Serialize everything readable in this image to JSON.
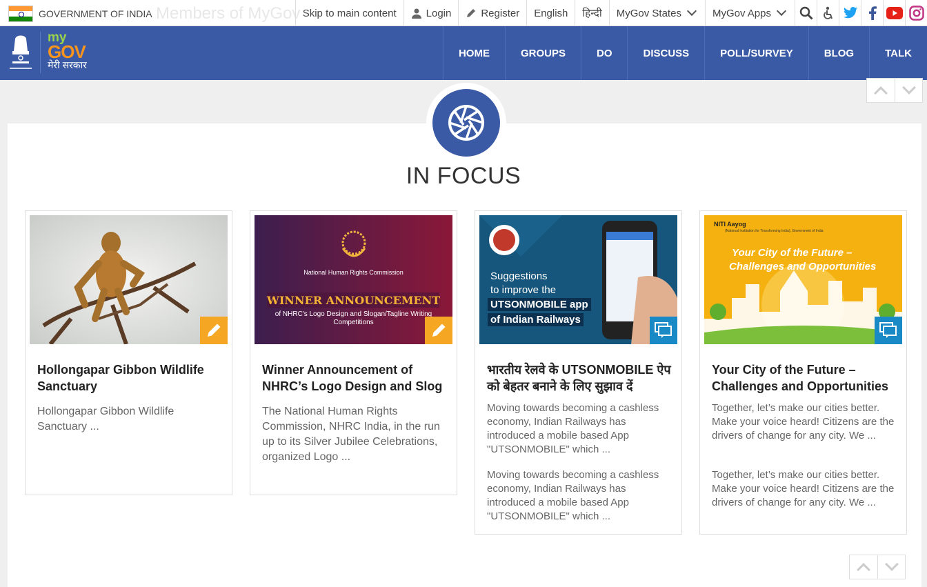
{
  "topbar": {
    "gov_label": "GOVERNMENT OF INDIA",
    "ghost_text": "Members of MyGov",
    "skip": "Skip to main content",
    "login": "Login",
    "register": "Register",
    "english": "English",
    "hindi": "हिन्दी",
    "states": "MyGov States",
    "apps": "MyGov Apps"
  },
  "brand": {
    "my": "my",
    "gov": "GOV",
    "hindi": "मेरी सरकार",
    "emblem_motto": "सत्यमेव जयते"
  },
  "nav": [
    "HOME",
    "GROUPS",
    "DO",
    "DISCUSS",
    "POLL/SURVEY",
    "BLOG",
    "TALK"
  ],
  "section": {
    "heading": "IN FOCUS"
  },
  "cards": [
    {
      "title": "Hollongapar Gibbon Wildlife Sanctuary",
      "desc": "Hollongapar Gibbon Wildlife Sanctuary ...",
      "badge": "pencil-icon"
    },
    {
      "title": "Winner Announcement of NHRC’s Logo Design and Slog",
      "desc": "The National Human Rights Commission, NHRC India, in the run up to its Silver Jubilee Celebrations, organized Logo ...",
      "badge": "pencil-icon",
      "img_org": "National Human Rights Commission",
      "img_headline": "WINNER ANNOUNCEMENT",
      "img_sub": "of NHRC's Logo Design and Slogan/Tagline Writing Competitions"
    },
    {
      "title": "भारतीय रेलवे के UTSONMOBILE ऐप को बेहतर बनाने के लिए सुझाव दें",
      "desc": "Moving towards becoming a cashless economy, Indian Railways has introduced a mobile based App \"UTSONMOBILE\" which ...",
      "desc2": "Moving towards becoming a cashless economy, Indian Railways has introduced a mobile based App \"UTSONMOBILE\" which ...",
      "badge": "discussion-icon",
      "img_l1": "Suggestions",
      "img_l2": "to improve the",
      "img_l3": "UTSONMOBILE app",
      "img_l4": "of Indian Railways"
    },
    {
      "title": "Your City of the Future – Challenges and Opportunities",
      "desc": "Together, let’s make our cities better. Make your voice heard! Citizens are the drivers of change for any city. We ...",
      "desc2": "Together, let’s make our cities better. Make your voice heard! Citizens are the drivers of change for any city. We ...",
      "badge": "discussion-icon",
      "img_org": "NITI Aayog",
      "img_org_sub": "(National Institution for Transforming India), Government of India",
      "img_l1": "Your City of the Future –",
      "img_l2": "Challenges and Opportunities"
    }
  ],
  "colors": {
    "nav": "#3a5aa6",
    "orange_badge": "#f5a623",
    "blue_badge": "#1a8ac6"
  }
}
